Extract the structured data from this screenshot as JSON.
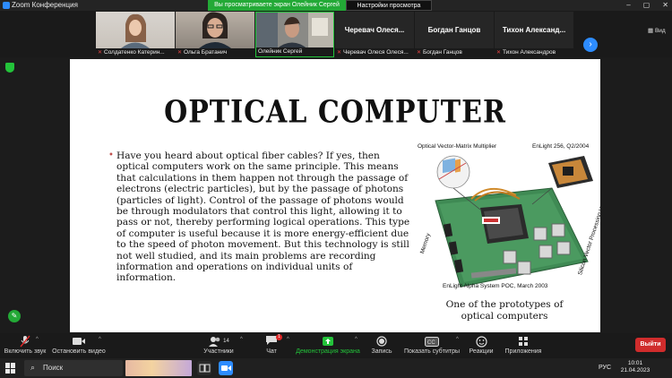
{
  "window": {
    "title": "Zoom Конференция",
    "share_banner": "Вы просматриваете экран Олейник Сергей",
    "view_settings": "Настройки просмотра"
  },
  "gallery": {
    "tiles": [
      {
        "name": "Солдатенко Катерин...",
        "muted": true,
        "type": "video"
      },
      {
        "name": "Ольга Братанич",
        "muted": true,
        "type": "video"
      },
      {
        "name": "Олейник Сергей",
        "muted": false,
        "type": "video",
        "active": true
      },
      {
        "big_name": "Черевач Олеся...",
        "name": "Черевач Олеся Олеся...",
        "muted": true,
        "type": "name"
      },
      {
        "big_name": "Богдан Ганцов",
        "name": "Богдан Ганцов",
        "muted": true,
        "type": "name"
      },
      {
        "big_name": "Тихон Александ...",
        "name": "Тихон Александров",
        "muted": true,
        "type": "name"
      }
    ],
    "view_toggle": "Вид"
  },
  "slide": {
    "title": "OPTICAL COMPUTER",
    "body": "Have you heard about optical fiber cables? If yes, then optical computers work on the same principle. This means that calculations in them happen not through the passage of electrons (electric particles), but by the passage of photons (particles of light). Control of the passage of photons would be through modulators that control this light, allowing it to pass or not, thereby performing logical operations. This type of computer is useful because it is more energy-efficient due to the speed of photon movement. But this technology is still not well studied, and its main problems are recording information and operations on individual units of information.",
    "figure": {
      "label_vmm": "Optical Vector-Matrix Multiplier",
      "label_enlight": "EnLight 256, Q2/2004",
      "label_memory": "Memory",
      "label_svpu": "Silicon Vector Processing Unit",
      "label_alpha": "EnLight Alpha System POC, March 2003"
    },
    "caption": "One of the prototypes of optical computers"
  },
  "toolbar": {
    "audio": "Включить звук",
    "video": "Остановить видео",
    "participants": "Участники",
    "participants_count": "14",
    "chat": "Чат",
    "chat_badge": "1",
    "share": "Демонстрация экрана",
    "record": "Запись",
    "subtitles": "Показать субтитры",
    "reactions": "Реакции",
    "apps": "Приложения",
    "leave": "Выйти"
  },
  "taskbar": {
    "search": "Поиск",
    "language": "РУС",
    "time": "10:01",
    "date": "21.04.2023"
  },
  "colors": {
    "zoom_blue": "#2d8cff",
    "share_green": "#23a936",
    "leave_red": "#d02c2c"
  }
}
